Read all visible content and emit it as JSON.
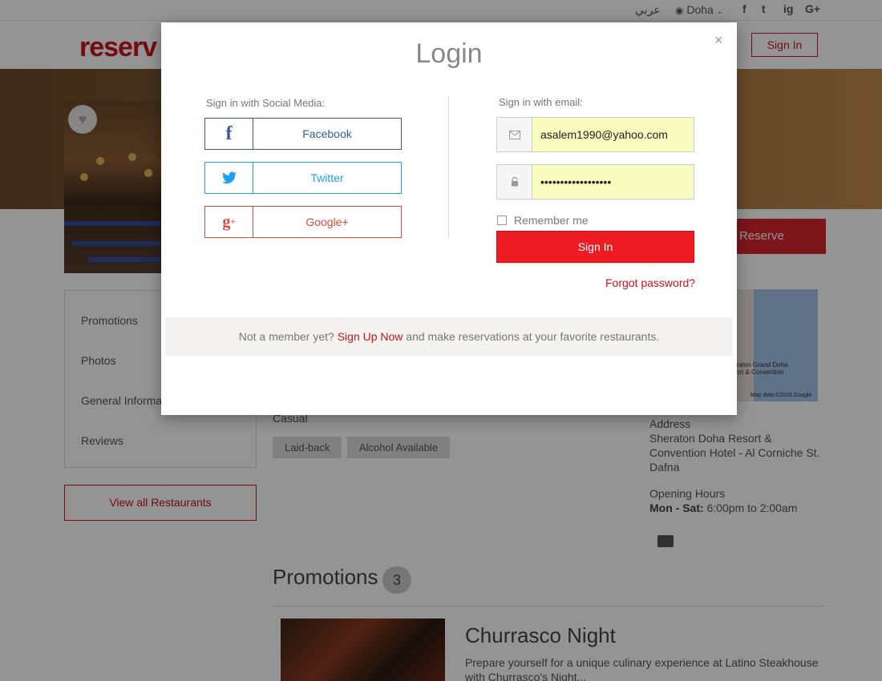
{
  "topbar": {
    "arabic": "عربي",
    "city": "Doha",
    "social": [
      "f",
      "t",
      "ig",
      "G+"
    ]
  },
  "navbar": {
    "logo": "reserv",
    "signin": "Sign In"
  },
  "hero": {
    "reserve": "Reserve"
  },
  "sidebar": {
    "items": [
      "Promotions",
      "Photos",
      "General Informa",
      "Reviews"
    ],
    "view_all": "View all Restaurants"
  },
  "map": {
    "place_label_1": "eraton Grand Doha",
    "place_label_2": "sort & Convention",
    "attribution": "Map data ©2016 Google"
  },
  "details": {
    "casual": "Casual",
    "tags": [
      "Laid-back",
      "Alcohol Available"
    ]
  },
  "info": {
    "address_label": "Address",
    "address_line1": "Sheraton Doha Resort &",
    "address_line2": "Convention Hotel - Al Corniche St.",
    "area": "Dafna",
    "hours_label": "Opening Hours",
    "hours_days": "Mon - Sat:",
    "hours_time": "6:00pm to 2:00am"
  },
  "promotions": {
    "title": "Promotions",
    "count": "3",
    "item_title": "Churrasco Night",
    "item_desc": "Prepare yourself for a unique culinary experience at Latino Steakhouse with Churrasco's Night..."
  },
  "modal": {
    "title": "Login",
    "close": "×",
    "social_heading": "Sign in with Social Media:",
    "facebook": "Facebook",
    "twitter": "Twitter",
    "google": "Google+",
    "email_heading": "Sign in with email:",
    "email_value": "asalem1990@yahoo.com",
    "password_value": "••••••••••••••••••",
    "remember": "Remember me",
    "signin": "Sign In",
    "forgot": "Forgot password?",
    "footer_pre": "Not a member yet?",
    "footer_link": "Sign Up Now",
    "footer_post": "and make reservations at your favorite restaurants."
  },
  "colors": {
    "brand_red": "#c4161c",
    "signin_red": "#ed1c24",
    "facebook": "#3b5998",
    "twitter": "#1da1f2",
    "google": "#dd4b39",
    "autofill": "#fafcbf"
  }
}
